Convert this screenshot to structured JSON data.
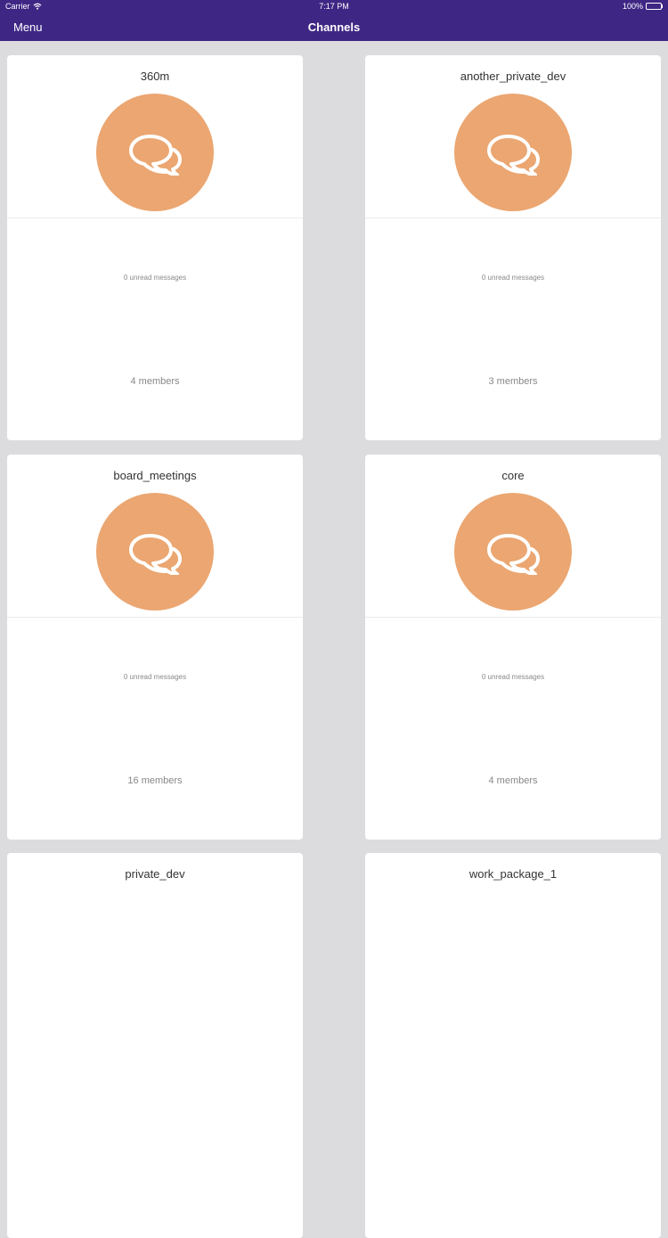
{
  "status_bar": {
    "carrier": "Carrier",
    "time": "7:17 PM",
    "battery": "100%"
  },
  "nav": {
    "menu_label": "Menu",
    "title": "Channels"
  },
  "colors": {
    "nav_bg": "#3e2784",
    "avatar_bg": "#eba671",
    "page_bg": "#dcdbde"
  },
  "channels": [
    {
      "name": "360m",
      "unread": "0 unread messages",
      "members": "4 members"
    },
    {
      "name": "another_private_dev",
      "unread": "0 unread messages",
      "members": "3 members"
    },
    {
      "name": "board_meetings",
      "unread": "0 unread messages",
      "members": "16 members"
    },
    {
      "name": "core",
      "unread": "0 unread messages",
      "members": "4 members"
    },
    {
      "name": "private_dev"
    },
    {
      "name": "work_package_1"
    }
  ],
  "icons": {
    "channel_avatar": "chat-bubbles-icon",
    "wifi": "wifi-icon",
    "battery": "battery-icon"
  }
}
